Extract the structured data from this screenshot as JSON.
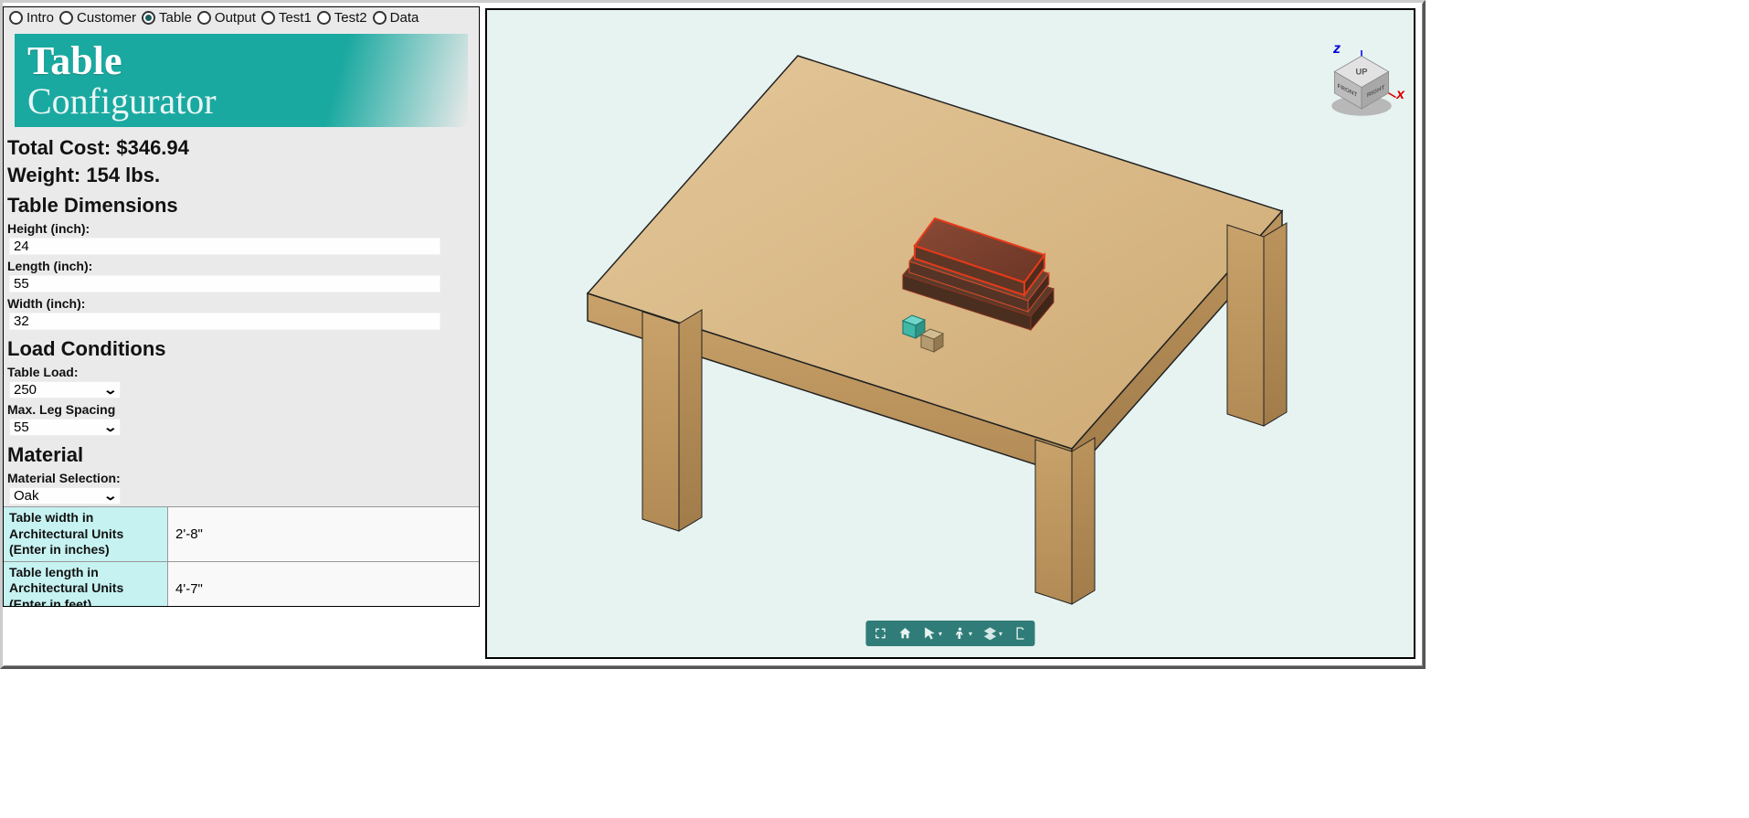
{
  "tabs": [
    {
      "label": "Intro",
      "checked": false
    },
    {
      "label": "Customer",
      "checked": false
    },
    {
      "label": "Table",
      "checked": true
    },
    {
      "label": "Output",
      "checked": false
    },
    {
      "label": "Test1",
      "checked": false
    },
    {
      "label": "Test2",
      "checked": false
    },
    {
      "label": "Data",
      "checked": false
    }
  ],
  "banner": {
    "line1": "Table",
    "line2": "Configurator"
  },
  "summary": {
    "total_cost": "Total Cost: $346.94",
    "weight": "Weight: 154 lbs."
  },
  "sections": {
    "dimensions_h": "Table Dimensions",
    "load_h": "Load Conditions",
    "material_h": "Material"
  },
  "fields": {
    "height_label": "Height (inch):",
    "height_value": "24",
    "length_label": "Length (inch):",
    "length_value": "55",
    "width_label": "Width (inch):",
    "width_value": "32",
    "table_load_label": "Table Load:",
    "table_load_value": "250",
    "max_leg_label": "Max. Leg Spacing",
    "max_leg_value": "55",
    "material_sel_label": "Material Selection:",
    "material_sel_value": "Oak",
    "arch_width_label": "Table width in Architectural Units (Enter in inches)",
    "arch_width_value": "2'-8\"",
    "arch_length_label": "Table length in Architectural Units (Enter in feet)",
    "arch_length_value": "4'-7\""
  },
  "view3d": {
    "axis_x": "x",
    "axis_z": "z",
    "cube_up": "UP",
    "cube_front": "FRONT",
    "cube_right": "RIGHT"
  },
  "toolbar3d": {
    "fullscreen": "fullscreen",
    "home": "home",
    "pointer": "pointer",
    "person": "person",
    "layers": "layers",
    "export": "export-pdf"
  }
}
